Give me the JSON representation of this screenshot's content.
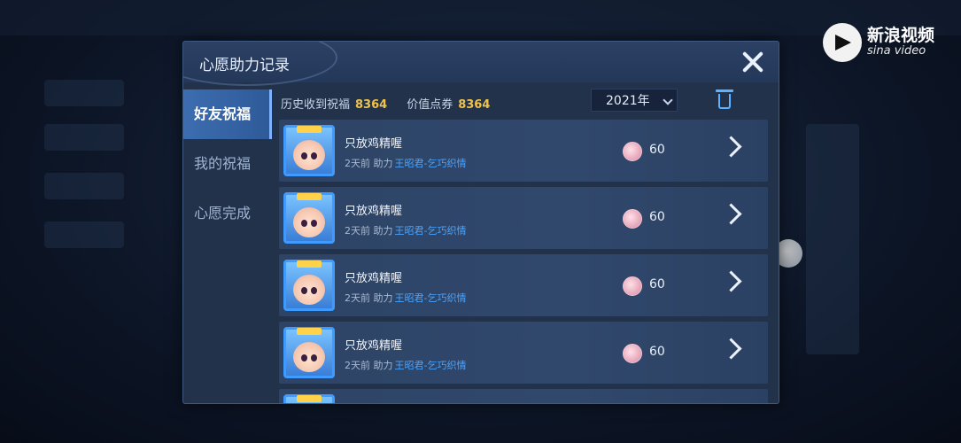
{
  "watermark": {
    "brand": "新浪视频",
    "sub": "sina video"
  },
  "dialog": {
    "title": "心愿助力记录"
  },
  "sidebar": {
    "items": [
      {
        "label": "好友祝福",
        "active": true
      },
      {
        "label": "我的祝福",
        "active": false
      },
      {
        "label": "心愿完成",
        "active": false
      }
    ]
  },
  "stats": {
    "history_label": "历史收到祝福",
    "history_value": "8364",
    "coupon_label": "价值点券",
    "coupon_value": "8364"
  },
  "year_select": {
    "value": "2021年"
  },
  "rows": [
    {
      "name": "只放鸡精喔",
      "time": "2天前",
      "action": "助力",
      "item": "王昭君-乞巧织情",
      "value": "60"
    },
    {
      "name": "只放鸡精喔",
      "time": "2天前",
      "action": "助力",
      "item": "王昭君-乞巧织情",
      "value": "60"
    },
    {
      "name": "只放鸡精喔",
      "time": "2天前",
      "action": "助力",
      "item": "王昭君-乞巧织情",
      "value": "60"
    },
    {
      "name": "只放鸡精喔",
      "time": "2天前",
      "action": "助力",
      "item": "王昭君-乞巧织情",
      "value": "60"
    }
  ],
  "colors": {
    "accent_gold": "#f0c24a",
    "link_blue": "#48a3ff",
    "active_tab": "#3d6db0"
  }
}
